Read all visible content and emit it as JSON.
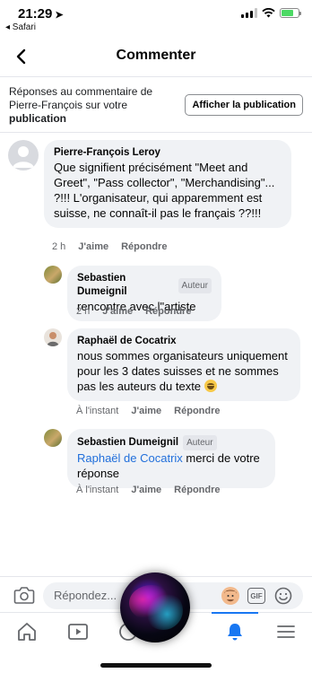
{
  "status_bar": {
    "time": "21:29",
    "back_app": "◂ Safari"
  },
  "header": {
    "title": "Commenter"
  },
  "context": {
    "text_line1": "Réponses au commentaire de",
    "text_line2": "Pierre-François sur votre",
    "text_bold": "publication",
    "button_label": "Afficher la publication"
  },
  "comments": [
    {
      "author": "Pierre-François Leroy",
      "text": "Que signifient précisément \"Meet and Greet\", \"Pass collector\", \"Merchandising\"... ?!!! L'organisateur, qui apparemment est suisse, ne connaît-il pas le français ??!!!",
      "time": "2 h",
      "like": "J'aime",
      "reply": "Répondre"
    },
    {
      "author": "Sebastien Dumeignil",
      "badge": "Auteur",
      "text": "rencontre avec l\"artiste",
      "time": "2 h",
      "like": "J'aime",
      "reply": "Répondre"
    },
    {
      "author": "Raphaël de Cocatrix",
      "text": "nous sommes organisateurs uniquement pour les 3 dates suisses et ne sommes pas les auteurs du texte",
      "time": "À l'instant",
      "like": "J'aime",
      "reply": "Répondre"
    },
    {
      "author": "Sebastien Dumeignil",
      "badge": "Auteur",
      "mention": "Raphaël de Cocatrix",
      "text": " merci de votre réponse",
      "time": "À l'instant",
      "like": "J'aime",
      "reply": "Répondre"
    }
  ],
  "composer": {
    "placeholder": "Répondez...",
    "gif_label": "GIF"
  },
  "colors": {
    "accent": "#1877f2",
    "mention": "#216fdb",
    "bubble": "#f0f2f5",
    "battery": "#4cd964"
  }
}
